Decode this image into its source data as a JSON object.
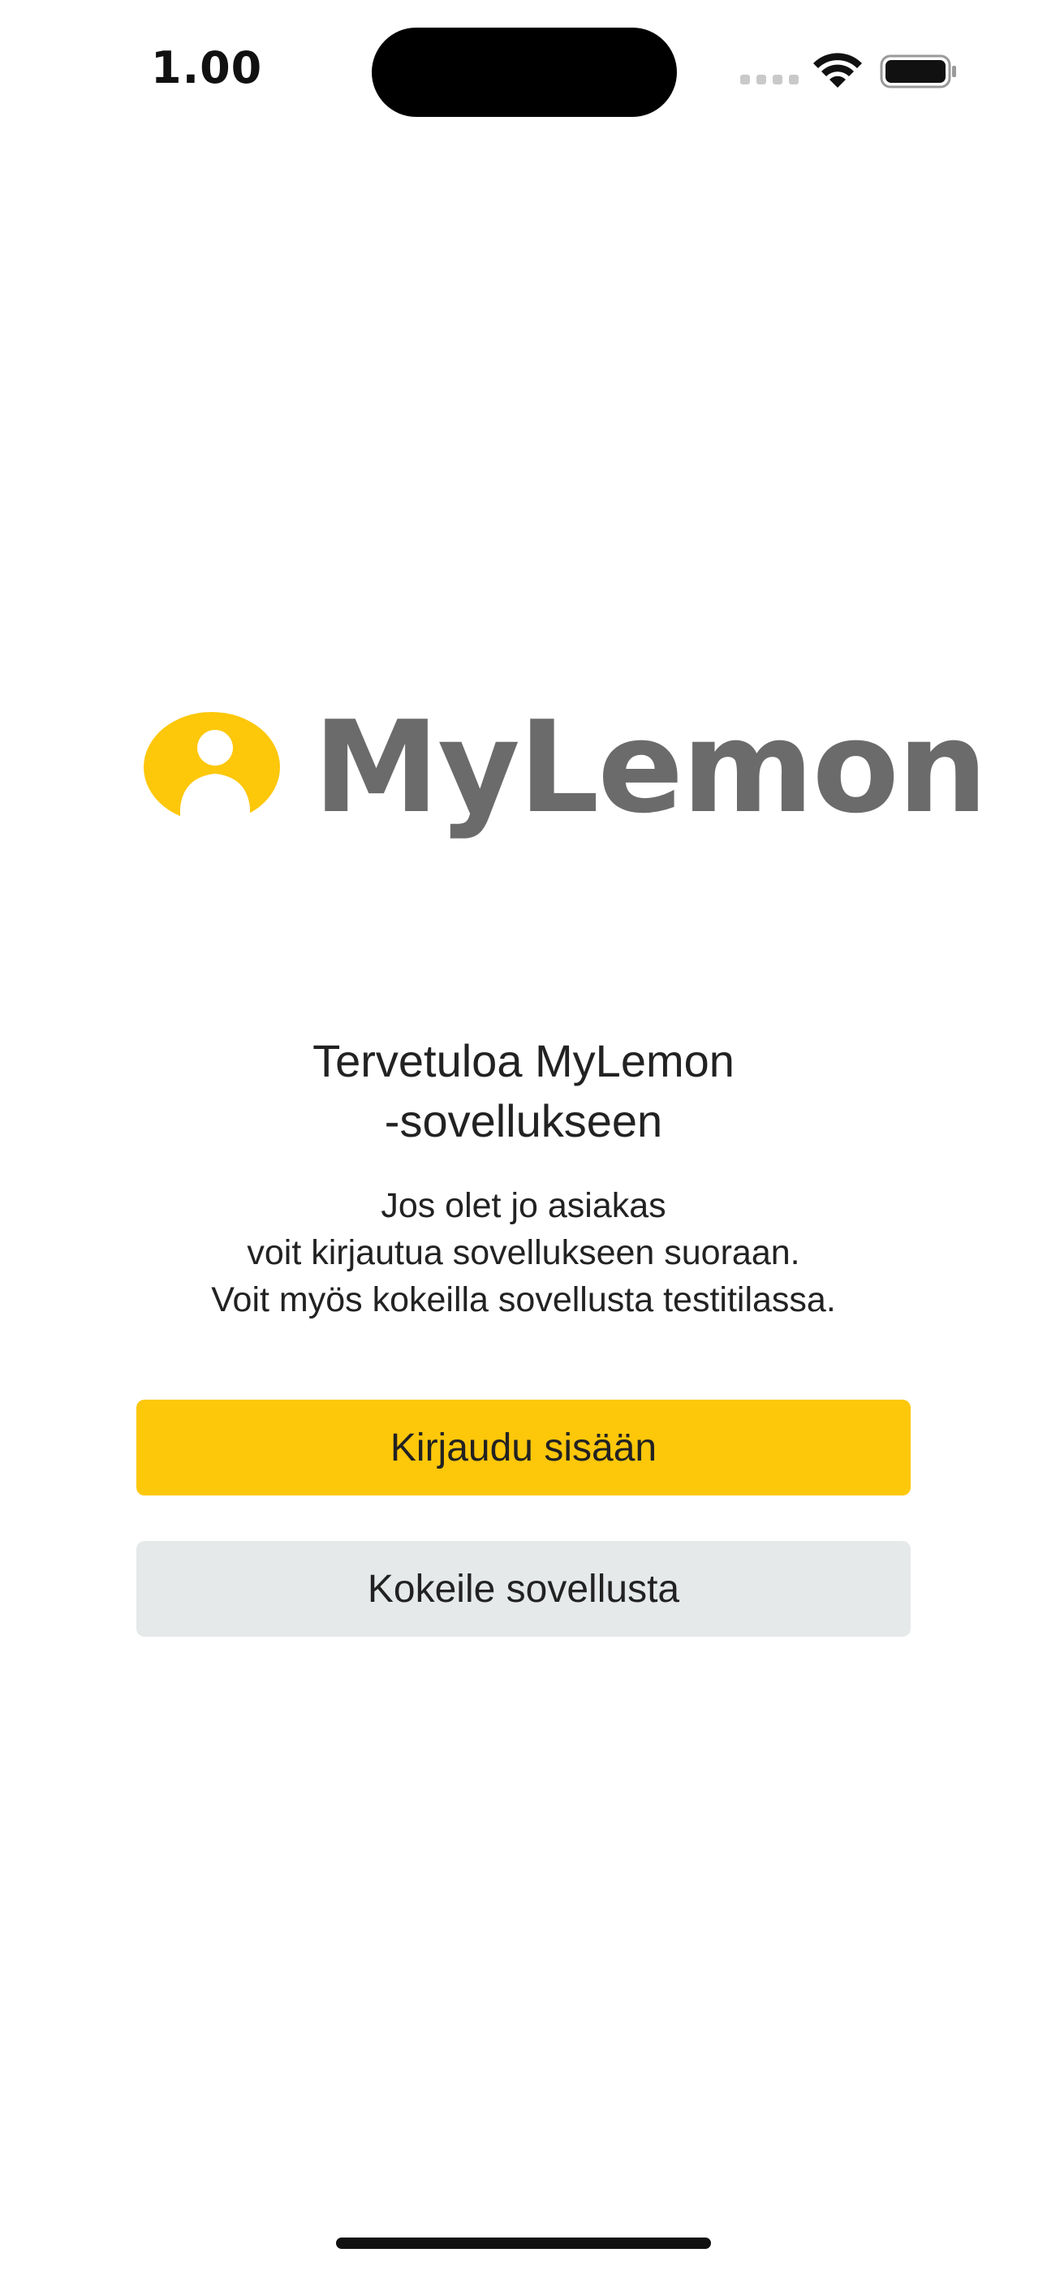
{
  "status_bar": {
    "time": "1.00",
    "icons": [
      "signal-icon",
      "wifi-icon",
      "battery-icon"
    ]
  },
  "logo": {
    "text": "MyLemon",
    "mark_color": "#fdc70a",
    "text_color": "#6b6b6b"
  },
  "welcome": {
    "title_line1": "Tervetuloa MyLemon",
    "title_line2": "-sovellukseen",
    "body_line1": "Jos olet jo asiakas",
    "body_line2": "voit kirjautua sovellukseen suoraan.",
    "body_line3": "Voit myös kokeilla sovellusta testitilassa."
  },
  "buttons": {
    "login_label": "Kirjaudu sisään",
    "try_label": "Kokeile sovellusta"
  },
  "colors": {
    "primary": "#fdc70a",
    "secondary": "#e6e9ea",
    "text": "#222222"
  }
}
